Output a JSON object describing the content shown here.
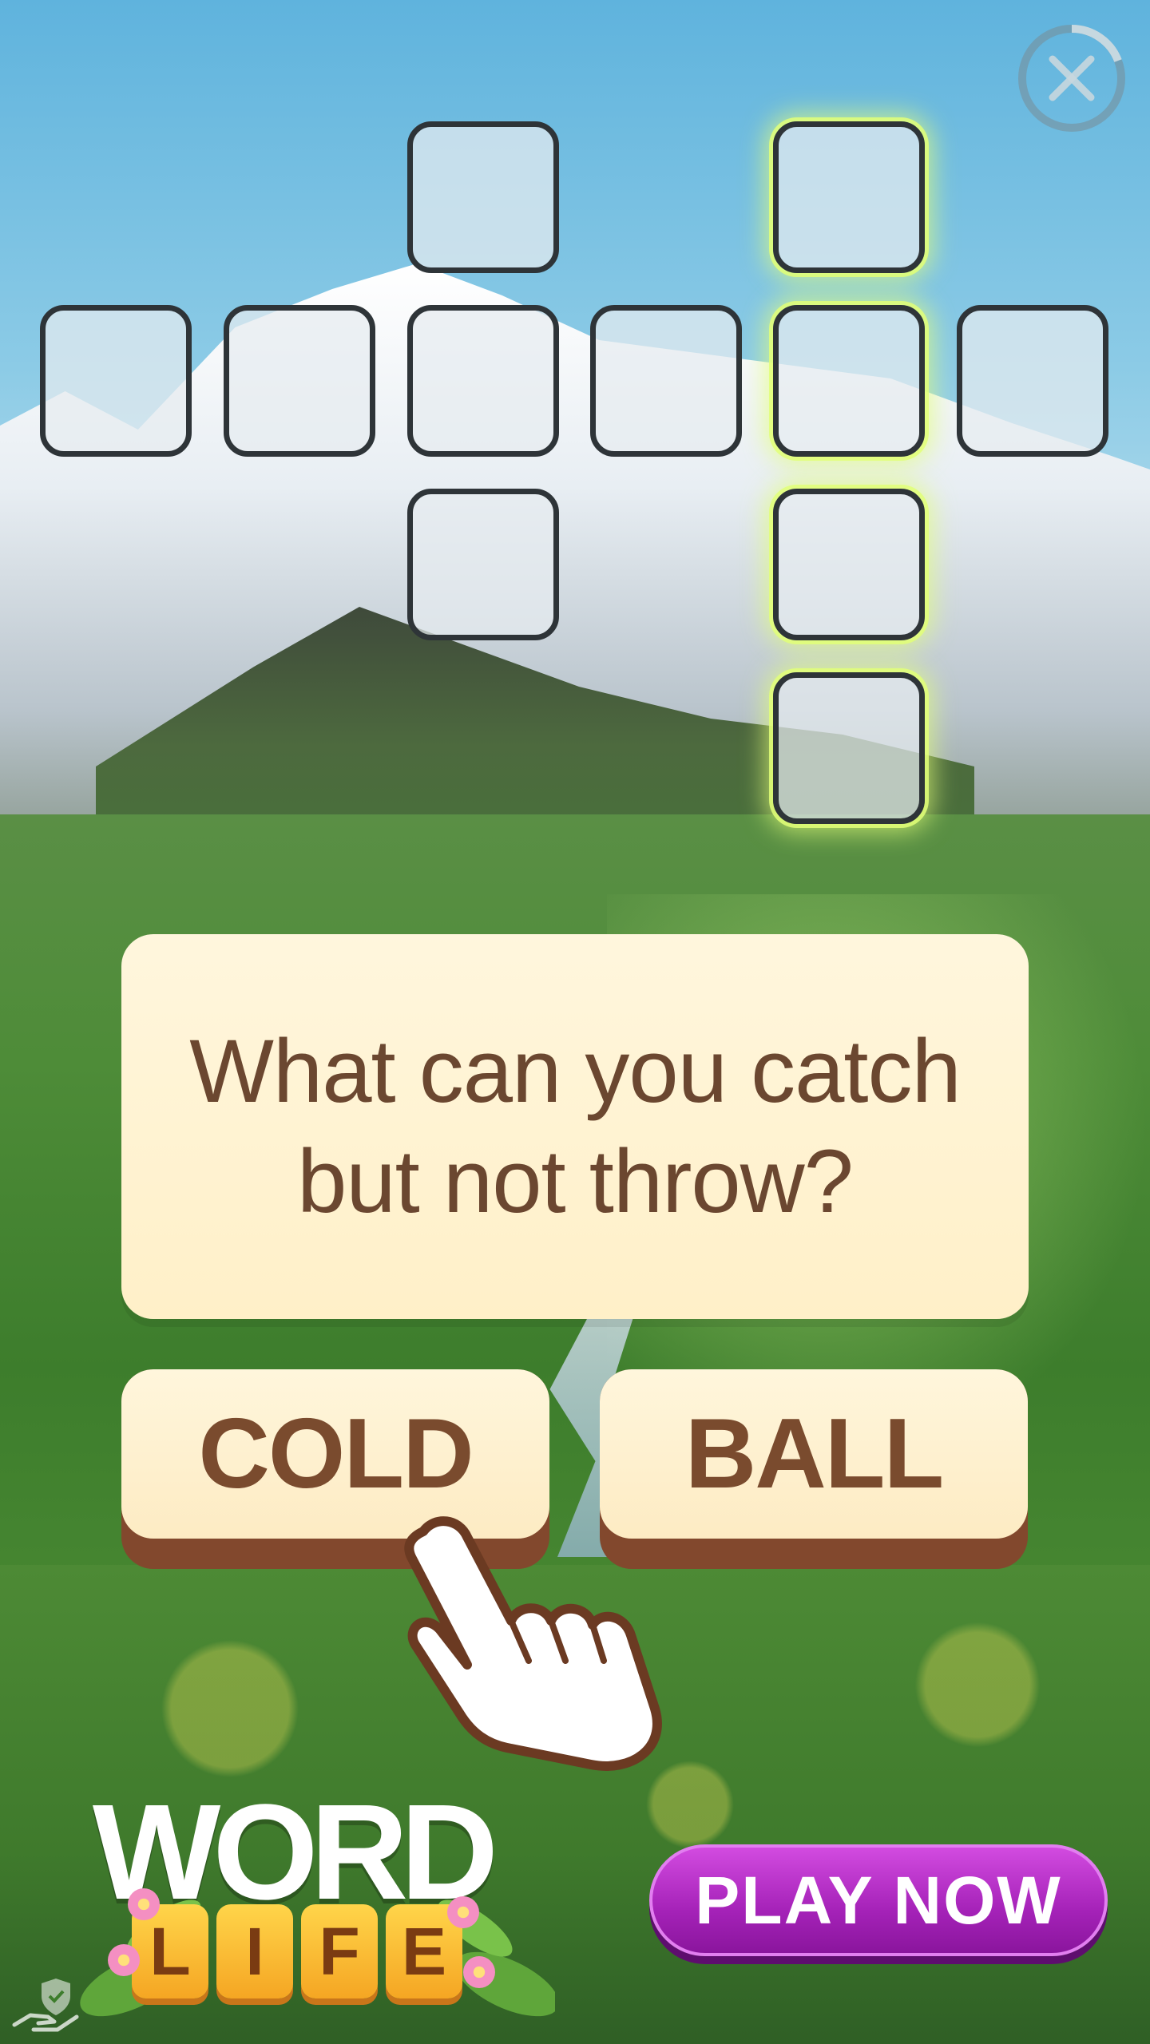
{
  "question": {
    "text": "What can you catch\nbut not throw?"
  },
  "answers": [
    {
      "label": "COLD"
    },
    {
      "label": "BALL"
    }
  ],
  "crossword": {
    "highlighted_word_color": "#e2ff78",
    "tile_count": 12
  },
  "branding": {
    "logo_top": "WORD",
    "logo_bottom": [
      "L",
      "I",
      "F",
      "E"
    ]
  },
  "cta": {
    "label": "PLAY NOW",
    "color": "#a522b8"
  },
  "icons": {
    "close": "close-icon",
    "hand": "pointing-hand-icon",
    "privacy": "privacy-shield-hand-icon"
  }
}
